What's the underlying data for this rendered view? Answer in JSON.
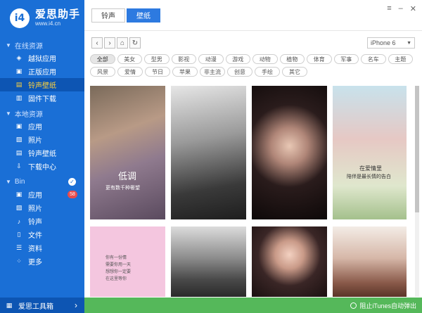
{
  "app": {
    "name": "爱思助手",
    "url": "www.i4.cn",
    "logo_mark": "i4"
  },
  "sidebar": {
    "groups": [
      {
        "title": "在线资源",
        "items": [
          {
            "label": "越狱应用",
            "icon": "store-icon"
          },
          {
            "label": "正版应用",
            "icon": "app-icon"
          },
          {
            "label": "铃声壁纸",
            "icon": "ringtone-wallpaper-icon",
            "active": true
          },
          {
            "label": "固件下载",
            "icon": "firmware-icon"
          }
        ]
      },
      {
        "title": "本地资源",
        "items": [
          {
            "label": "应用",
            "icon": "app-icon"
          },
          {
            "label": "照片",
            "icon": "photo-icon"
          },
          {
            "label": "铃声壁纸",
            "icon": "ringtone-wallpaper-icon"
          },
          {
            "label": "下载中心",
            "icon": "download-icon"
          }
        ]
      },
      {
        "title": "Bin",
        "items": [
          {
            "label": "应用",
            "icon": "app-icon",
            "badge": "58"
          },
          {
            "label": "照片",
            "icon": "photo-icon"
          },
          {
            "label": "铃声",
            "icon": "bell-icon"
          },
          {
            "label": "文件",
            "icon": "file-icon"
          },
          {
            "label": "资料",
            "icon": "contacts-icon"
          },
          {
            "label": "更多",
            "icon": "more-icon"
          }
        ]
      }
    ],
    "toolbox_label": "爱思工具箱"
  },
  "tabs": [
    {
      "label": "铃声",
      "active": false
    },
    {
      "label": "壁纸",
      "active": true
    }
  ],
  "device_select": "iPhone 6",
  "categories_row1": [
    "全部",
    "美女",
    "型男",
    "影视",
    "动漫",
    "游戏",
    "动物",
    "植物",
    "体育",
    "军事",
    "名车",
    "主题"
  ],
  "categories_row2": [
    "风景",
    "爱情",
    "节日",
    "苹果",
    "非主流",
    "创意",
    "手绘",
    "其它"
  ],
  "wallpaper_captions": {
    "w1_title": "低调",
    "w1_sub": "更有数千种奢望",
    "w4_line1": "在爱情里",
    "w4_line2": "陪伴是最长情的告白",
    "w5_line1": "你有一份情",
    "w5_line2": "需要你用一天",
    "w5_line3": "想想你一定要",
    "w5_line4": "在这里等你"
  },
  "status": {
    "text": "阻止iTunes自动弹出"
  },
  "colors": {
    "sidebar": "#1a6fd6",
    "accent": "#2d7ae0",
    "status_bar": "#55b85a",
    "active_label": "#ffd23c"
  }
}
